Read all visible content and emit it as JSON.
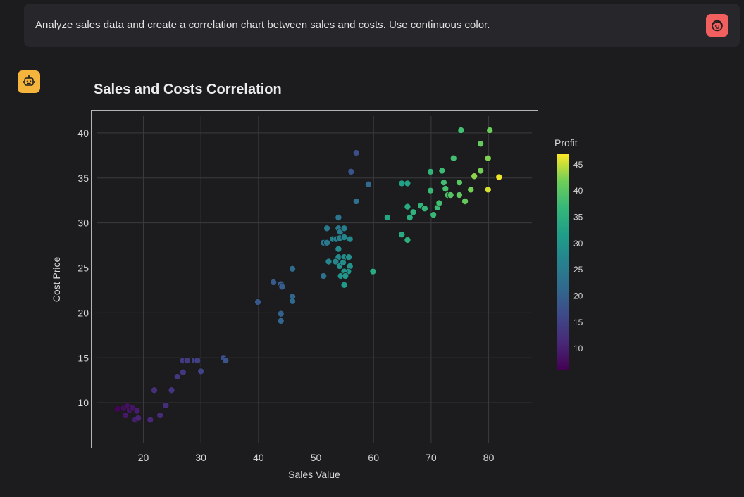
{
  "prompt": {
    "text": "Analyze sales data and create a correlation chart between sales and costs. Use continuous color."
  },
  "icons": {
    "user_avatar": "user-face-icon",
    "assistant_avatar": "robot-icon"
  },
  "colors": {
    "background": "#1c1c1e",
    "prompt_bg": "#26262b",
    "user_avatar": "#f25f5f",
    "assistant_avatar": "#f5b53d",
    "colormap": "viridis"
  },
  "chart_data": {
    "type": "scatter",
    "title": "Sales and Costs Correlation",
    "xlabel": "Sales Value",
    "ylabel": "Cost Price",
    "xlim": [
      11,
      88.5
    ],
    "ylim": [
      5,
      42.5
    ],
    "xticks": [
      20,
      30,
      40,
      50,
      60,
      70,
      80
    ],
    "yticks": [
      10,
      15,
      20,
      25,
      30,
      35,
      40
    ],
    "grid": true,
    "colorbar": {
      "title": "Profit",
      "range": [
        6,
        47
      ],
      "ticks": [
        10,
        15,
        20,
        25,
        30,
        35,
        40,
        45
      ]
    },
    "points": [
      {
        "x": 15.5,
        "y": 9.3,
        "c": 6.5
      },
      {
        "x": 16.6,
        "y": 9.4,
        "c": 7.5
      },
      {
        "x": 17.2,
        "y": 9.6,
        "c": 8
      },
      {
        "x": 17.6,
        "y": 9.2,
        "c": 8.5
      },
      {
        "x": 16.9,
        "y": 8.6,
        "c": 9
      },
      {
        "x": 18.1,
        "y": 9.4,
        "c": 8.5
      },
      {
        "x": 18.9,
        "y": 9.1,
        "c": 9.5
      },
      {
        "x": 18.6,
        "y": 8.1,
        "c": 10
      },
      {
        "x": 19.1,
        "y": 8.3,
        "c": 10.5
      },
      {
        "x": 21.2,
        "y": 8.1,
        "c": 11
      },
      {
        "x": 22.9,
        "y": 8.6,
        "c": 11.5
      },
      {
        "x": 23.9,
        "y": 9.7,
        "c": 12
      },
      {
        "x": 21.9,
        "y": 11.4,
        "c": 12
      },
      {
        "x": 24.9,
        "y": 11.4,
        "c": 13
      },
      {
        "x": 25.9,
        "y": 12.9,
        "c": 13.5
      },
      {
        "x": 26.9,
        "y": 13.4,
        "c": 13.5
      },
      {
        "x": 26.9,
        "y": 14.7,
        "c": 14
      },
      {
        "x": 27.6,
        "y": 14.7,
        "c": 14
      },
      {
        "x": 28.9,
        "y": 14.7,
        "c": 14.5
      },
      {
        "x": 29.4,
        "y": 14.7,
        "c": 15
      },
      {
        "x": 30.0,
        "y": 13.5,
        "c": 15.5
      },
      {
        "x": 33.9,
        "y": 15.0,
        "c": 17.5
      },
      {
        "x": 34.3,
        "y": 14.7,
        "c": 18
      },
      {
        "x": 39.9,
        "y": 21.2,
        "c": 18.5
      },
      {
        "x": 42.6,
        "y": 23.4,
        "c": 19
      },
      {
        "x": 43.9,
        "y": 23.2,
        "c": 19.5
      },
      {
        "x": 44.1,
        "y": 22.9,
        "c": 19.5
      },
      {
        "x": 43.9,
        "y": 19.9,
        "c": 20.5
      },
      {
        "x": 43.9,
        "y": 19.1,
        "c": 21
      },
      {
        "x": 45.9,
        "y": 21.8,
        "c": 21
      },
      {
        "x": 45.9,
        "y": 21.3,
        "c": 21.5
      },
      {
        "x": 45.9,
        "y": 24.9,
        "c": 22
      },
      {
        "x": 51.3,
        "y": 24.1,
        "c": 23
      },
      {
        "x": 57.0,
        "y": 37.8,
        "c": 17
      },
      {
        "x": 56.1,
        "y": 35.7,
        "c": 18
      },
      {
        "x": 59.1,
        "y": 34.3,
        "c": 22
      },
      {
        "x": 57.0,
        "y": 32.4,
        "c": 23
      },
      {
        "x": 53.9,
        "y": 30.6,
        "c": 24
      },
      {
        "x": 51.9,
        "y": 29.4,
        "c": 24.5
      },
      {
        "x": 51.3,
        "y": 27.8,
        "c": 23.5
      },
      {
        "x": 51.9,
        "y": 27.8,
        "c": 24.5
      },
      {
        "x": 53.9,
        "y": 29.4,
        "c": 25
      },
      {
        "x": 54.2,
        "y": 29.0,
        "c": 25.5
      },
      {
        "x": 54.9,
        "y": 29.4,
        "c": 26
      },
      {
        "x": 52.9,
        "y": 28.2,
        "c": 26.5
      },
      {
        "x": 53.5,
        "y": 28.2,
        "c": 26
      },
      {
        "x": 54.1,
        "y": 28.3,
        "c": 26.5
      },
      {
        "x": 54.9,
        "y": 28.4,
        "c": 27
      },
      {
        "x": 55.9,
        "y": 28.2,
        "c": 27.5
      },
      {
        "x": 53.9,
        "y": 27.1,
        "c": 28
      },
      {
        "x": 53.9,
        "y": 26.2,
        "c": 28
      },
      {
        "x": 52.2,
        "y": 25.7,
        "c": 27
      },
      {
        "x": 53.4,
        "y": 25.7,
        "c": 27.5
      },
      {
        "x": 54.1,
        "y": 25.2,
        "c": 29
      },
      {
        "x": 54.9,
        "y": 26.2,
        "c": 28.5
      },
      {
        "x": 55.7,
        "y": 26.2,
        "c": 29
      },
      {
        "x": 54.7,
        "y": 25.6,
        "c": 28.5
      },
      {
        "x": 55.9,
        "y": 25.2,
        "c": 29.5
      },
      {
        "x": 55.6,
        "y": 24.6,
        "c": 30
      },
      {
        "x": 54.9,
        "y": 24.6,
        "c": 30
      },
      {
        "x": 54.3,
        "y": 24.1,
        "c": 29.5
      },
      {
        "x": 55.1,
        "y": 24.1,
        "c": 30.5
      },
      {
        "x": 54.9,
        "y": 23.1,
        "c": 31
      },
      {
        "x": 59.9,
        "y": 24.6,
        "c": 34
      },
      {
        "x": 62.4,
        "y": 30.6,
        "c": 33
      },
      {
        "x": 64.9,
        "y": 34.4,
        "c": 32
      },
      {
        "x": 65.9,
        "y": 34.4,
        "c": 32.5
      },
      {
        "x": 64.9,
        "y": 28.7,
        "c": 34
      },
      {
        "x": 65.9,
        "y": 28.1,
        "c": 35
      },
      {
        "x": 65.9,
        "y": 31.8,
        "c": 34
      },
      {
        "x": 66.3,
        "y": 30.6,
        "c": 35
      },
      {
        "x": 66.9,
        "y": 31.2,
        "c": 35.5
      },
      {
        "x": 68.2,
        "y": 31.9,
        "c": 36
      },
      {
        "x": 68.9,
        "y": 31.6,
        "c": 36.5
      },
      {
        "x": 69.9,
        "y": 35.7,
        "c": 36
      },
      {
        "x": 69.9,
        "y": 33.6,
        "c": 37
      },
      {
        "x": 70.4,
        "y": 30.9,
        "c": 37
      },
      {
        "x": 71.1,
        "y": 31.7,
        "c": 37.5
      },
      {
        "x": 71.4,
        "y": 32.2,
        "c": 38
      },
      {
        "x": 71.9,
        "y": 35.8,
        "c": 37.5
      },
      {
        "x": 72.2,
        "y": 34.5,
        "c": 38
      },
      {
        "x": 72.5,
        "y": 33.8,
        "c": 38.5
      },
      {
        "x": 72.9,
        "y": 33.1,
        "c": 39
      },
      {
        "x": 73.4,
        "y": 33.1,
        "c": 39.5
      },
      {
        "x": 73.9,
        "y": 37.2,
        "c": 38
      },
      {
        "x": 74.9,
        "y": 34.5,
        "c": 40
      },
      {
        "x": 74.9,
        "y": 33.1,
        "c": 40.5
      },
      {
        "x": 75.2,
        "y": 40.3,
        "c": 38
      },
      {
        "x": 75.9,
        "y": 32.4,
        "c": 41
      },
      {
        "x": 76.9,
        "y": 33.7,
        "c": 42
      },
      {
        "x": 77.5,
        "y": 35.2,
        "c": 43
      },
      {
        "x": 78.6,
        "y": 35.8,
        "c": 42
      },
      {
        "x": 78.6,
        "y": 38.8,
        "c": 41
      },
      {
        "x": 79.9,
        "y": 37.2,
        "c": 42.5
      },
      {
        "x": 80.2,
        "y": 40.3,
        "c": 41.5
      },
      {
        "x": 79.9,
        "y": 33.7,
        "c": 45.5
      },
      {
        "x": 81.8,
        "y": 35.1,
        "c": 46.5
      }
    ]
  }
}
